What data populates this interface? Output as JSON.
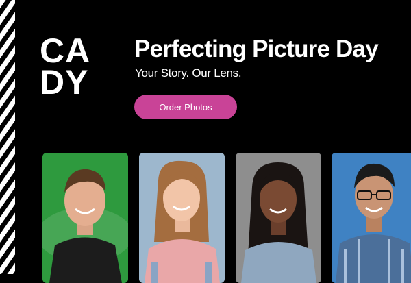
{
  "brand": {
    "logo_line1": "CA",
    "logo_line2": "DY"
  },
  "hero": {
    "headline": "Perfecting Picture Day",
    "tagline": "Your Story. Our Lens."
  },
  "cta": {
    "label": "Order Photos",
    "color": "#c94397"
  },
  "photos": [
    {
      "name": "student-portrait-1",
      "background": "#2e9a3e"
    },
    {
      "name": "student-portrait-2",
      "background": "#9db7cd"
    },
    {
      "name": "student-portrait-3",
      "background": "#8e8e8e"
    },
    {
      "name": "student-portrait-4",
      "background": "#3f82c3"
    }
  ]
}
